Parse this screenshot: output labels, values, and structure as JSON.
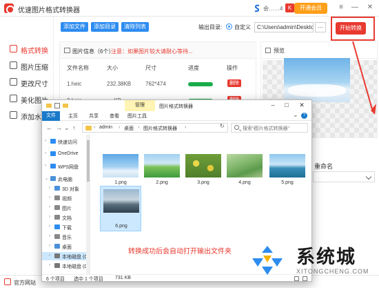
{
  "app": {
    "title": "优速图片格式转换器",
    "vip_user": "会……4",
    "vip_flag": "K",
    "open_vip": "开通会员",
    "window_controls": [
      "≡",
      "—",
      "✕"
    ]
  },
  "sidebar": {
    "items": [
      {
        "label": "格式转换",
        "active": true
      },
      {
        "label": "图片压缩"
      },
      {
        "label": "更改尺寸"
      },
      {
        "label": "美化图片"
      },
      {
        "label": "添加水印"
      }
    ]
  },
  "toolbar": {
    "add_file": "添加文件",
    "add_dir": "添加目录",
    "clear_list": "清除列表",
    "output_label": "输出目录:",
    "custom_label": "自定义",
    "path_value": "C:\\Users\\admin\\Deskto",
    "browse": "···",
    "start": "开始转换"
  },
  "list": {
    "title": "图片信息（6个）",
    "warning": "注意：如果图片较大请耐心等待...",
    "columns": [
      "文件名称",
      "大小",
      "尺寸",
      "进度",
      "操作"
    ],
    "rows": [
      {
        "name": "1.heic",
        "size": "232.38KB",
        "dim": "762*474",
        "progress": 1.0,
        "action": "删除"
      },
      {
        "name": "2.heic",
        "size": "··· KB",
        "dim": "···",
        "progress": 1.0,
        "action": "删除"
      }
    ]
  },
  "preview": {
    "label": "预览"
  },
  "rename": {
    "label": "重命名"
  },
  "footer": {
    "label": "官方网站"
  },
  "explorer": {
    "manage_tab": "管理",
    "window_title": "图片格式转换器",
    "tabs": [
      "文件",
      "主页",
      "共享",
      "查看",
      "图片工具"
    ],
    "help": "?",
    "address": [
      "admin",
      "桌面",
      "图片格式转换器"
    ],
    "search_placeholder": "搜索\"图片格式转换器\"",
    "nav": [
      {
        "label": "快速访问",
        "icon_color": "#2d8cf0"
      },
      {
        "label": "OneDrive",
        "icon_color": "#2d8cf0"
      },
      {
        "label": "WPS网盘",
        "icon_color": "#2d8cf0"
      },
      {
        "label": "此电脑",
        "icon_color": "#4a90d9"
      },
      {
        "label": "3D 对象",
        "icon_color": "#4a90d9"
      },
      {
        "label": "视频",
        "icon_color": "#888888"
      },
      {
        "label": "图片",
        "icon_color": "#888888"
      },
      {
        "label": "文档",
        "icon_color": "#888888"
      },
      {
        "label": "下载",
        "icon_color": "#2d8cf0"
      },
      {
        "label": "音乐",
        "icon_color": "#888888"
      },
      {
        "label": "桌面",
        "icon_color": "#4a90d9"
      },
      {
        "label": "本地磁盘 (C:",
        "icon_color": "#777777"
      },
      {
        "label": "本地磁盘 (D",
        "icon_color": "#777777"
      }
    ],
    "files": [
      "1.png",
      "2.png",
      "3.png",
      "4.png",
      "5.png",
      "6.png"
    ],
    "message": "转换成功后会自动打开输出文件夹",
    "status": {
      "count": "6 个项目",
      "selected": "选中 1 个项目",
      "size": "731 KB"
    }
  },
  "watermark": {
    "text": "系统城",
    "url": "XITONGCHENG.COM"
  },
  "colors": {
    "accent": "#e8392f",
    "blue": "#2d8cf0",
    "progress": "#1aad4b",
    "vip": "#ff9f1a"
  }
}
